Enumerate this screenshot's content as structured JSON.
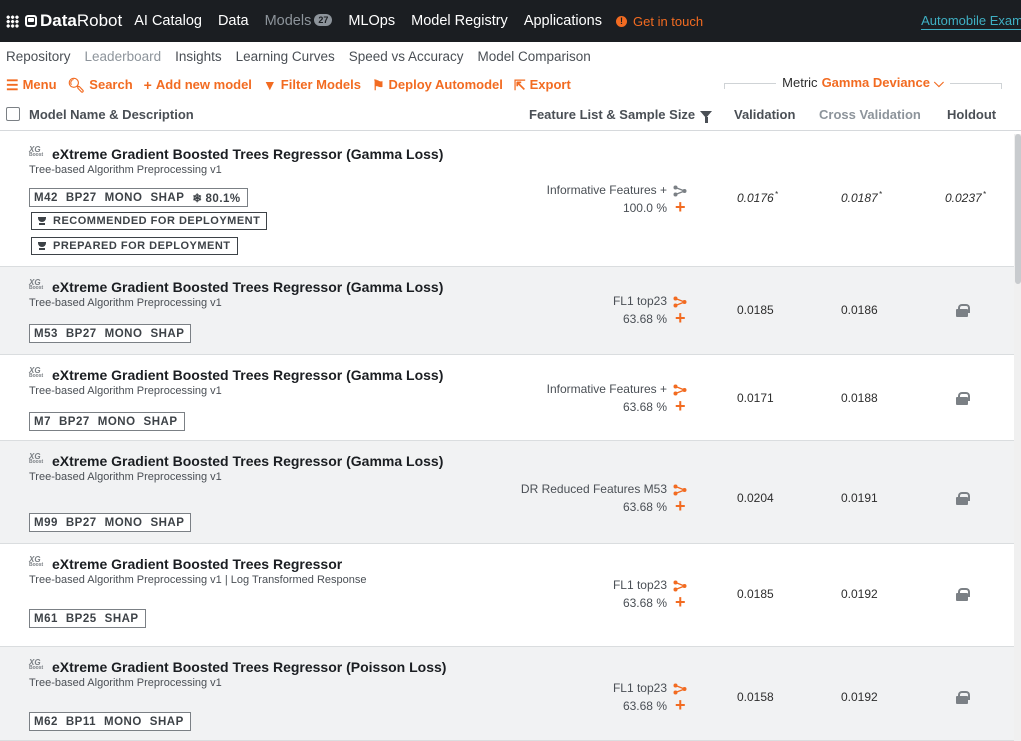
{
  "nav": {
    "brand_a": "Data",
    "brand_b": "Robot",
    "items": [
      "AI Catalog",
      "Data",
      "Models",
      "MLOps",
      "Model Registry",
      "Applications"
    ],
    "models_badge": "27",
    "get_in_touch": "Get in touch",
    "project": "Automobile Exam"
  },
  "subnav": [
    "Repository",
    "Leaderboard",
    "Insights",
    "Learning Curves",
    "Speed vs Accuracy",
    "Model Comparison"
  ],
  "toolbar": {
    "menu": "Menu",
    "search": "Search",
    "add": "Add new model",
    "filter": "Filter Models",
    "deploy": "Deploy Automodel",
    "export": "Export",
    "metric_label": "Metric",
    "metric_value": "Gamma Deviance"
  },
  "header": {
    "name": "Model Name & Description",
    "feature": "Feature List & Sample Size",
    "validation": "Validation",
    "cv": "Cross Validation",
    "holdout": "Holdout"
  },
  "colors": {
    "accent": "#f26b21",
    "nav_bg": "#1b1e22",
    "link": "#3fb0c4"
  },
  "rows": [
    {
      "name": "eXtreme Gradient Boosted Trees Regressor (Gamma Loss)",
      "desc": "Tree-based Algorithm Preprocessing v1",
      "tags": [
        "M42",
        "BP27",
        "MONO",
        "SHAP"
      ],
      "extra": "80.1%",
      "badges": [
        "RECOMMENDED FOR DEPLOYMENT",
        "PREPARED FOR DEPLOYMENT"
      ],
      "feature": "Informative Features +",
      "sample": "100.0 %",
      "validation": "0.0176",
      "cv": "0.0187",
      "holdout": "0.0237",
      "icon_color": "#7b8085"
    },
    {
      "name": "eXtreme Gradient Boosted Trees Regressor (Gamma Loss)",
      "desc": "Tree-based Algorithm Preprocessing v1",
      "tags": [
        "M53",
        "BP27",
        "MONO",
        "SHAP"
      ],
      "feature": "FL1 top23",
      "sample": "63.68 %",
      "validation": "0.0185",
      "cv": "0.0186",
      "icon_color": "#f26b21"
    },
    {
      "name": "eXtreme Gradient Boosted Trees Regressor (Gamma Loss)",
      "desc": "Tree-based Algorithm Preprocessing v1",
      "tags": [
        "M7",
        "BP27",
        "MONO",
        "SHAP"
      ],
      "feature": "Informative Features +",
      "sample": "63.68 %",
      "validation": "0.0171",
      "cv": "0.0188",
      "icon_color": "#f26b21"
    },
    {
      "name": "eXtreme Gradient Boosted Trees Regressor (Gamma Loss)",
      "desc": "Tree-based Algorithm Preprocessing v1",
      "tags": [
        "M99",
        "BP27",
        "MONO",
        "SHAP"
      ],
      "feature": "DR Reduced Features M53",
      "sample": "63.68 %",
      "validation": "0.0204",
      "cv": "0.0191",
      "icon_color": "#f26b21"
    },
    {
      "name": "eXtreme Gradient Boosted Trees Regressor",
      "desc": "Tree-based Algorithm Preprocessing v1 | Log Transformed Response",
      "tags": [
        "M61",
        "BP25",
        "SHAP"
      ],
      "feature": "FL1 top23",
      "sample": "63.68 %",
      "validation": "0.0185",
      "cv": "0.0192",
      "icon_color": "#f26b21"
    },
    {
      "name": "eXtreme Gradient Boosted Trees Regressor (Poisson Loss)",
      "desc": "Tree-based Algorithm Preprocessing v1",
      "tags": [
        "M62",
        "BP11",
        "MONO",
        "SHAP"
      ],
      "feature": "FL1 top23",
      "sample": "63.68 %",
      "validation": "0.0158",
      "cv": "0.0192",
      "icon_color": "#f26b21"
    }
  ]
}
